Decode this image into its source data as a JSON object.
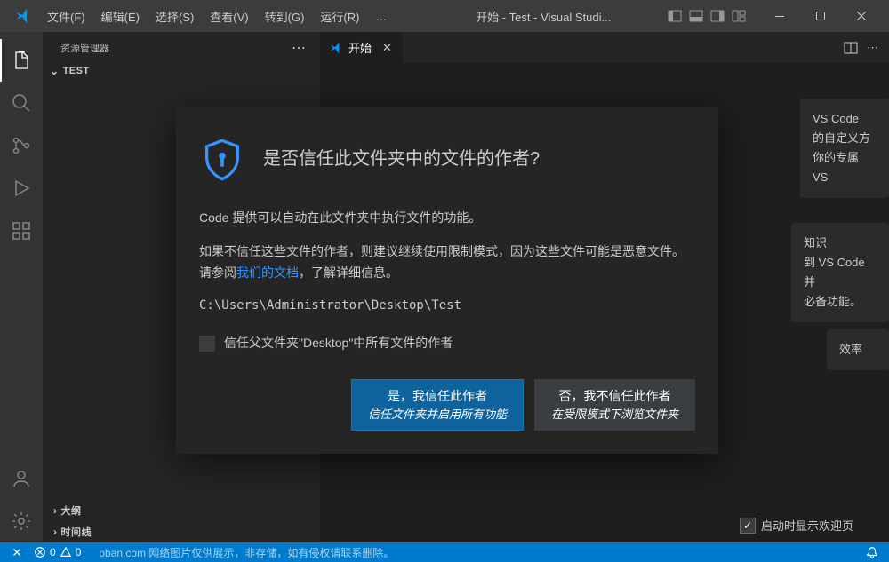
{
  "titlebar": {
    "menu": {
      "file": "文件(F)",
      "edit": "编辑(E)",
      "select": "选择(S)",
      "view": "查看(V)",
      "goto": "转到(G)",
      "run": "运行(R)",
      "more": "…"
    },
    "title": "开始 - Test - Visual Studi..."
  },
  "sidebar": {
    "header": "资源管理器",
    "project": "TEST",
    "outline": "大纲",
    "timeline": "时间线"
  },
  "tab": {
    "name": "开始"
  },
  "background_cards": {
    "c1_l1": "VS Code",
    "c1_l2": "的自定义方",
    "c1_l3": "你的专属 VS",
    "c2_l1": "知识",
    "c2_l2": "到 VS Code 并",
    "c2_l3": "必备功能。",
    "c3_l1": "效率"
  },
  "welcome_checkbox": "启动时显示欢迎页",
  "modal": {
    "title": "是否信任此文件夹中的文件的作者?",
    "p1": "Code 提供可以自动在此文件夹中执行文件的功能。",
    "p2a": "如果不信任这些文件的作者，则建议继续使用限制模式，因为这些文件可能是恶意文件。请参阅",
    "p2link": "我们的文档",
    "p2b": "，了解详细信息。",
    "path": "C:\\Users\\Administrator\\Desktop\\Test",
    "checkbox": "信任父文件夹\"Desktop\"中所有文件的作者",
    "yes_main": "是，我信任此作者",
    "yes_sub": "信任文件夹并启用所有功能",
    "no_main": "否，我不信任此作者",
    "no_sub": "在受限模式下浏览文件夹"
  },
  "statusbar": {
    "errors": "0",
    "warnings": "0",
    "watermark": "oban.com 网络图片仅供展示，非存储，如有侵权请联系删除。"
  }
}
